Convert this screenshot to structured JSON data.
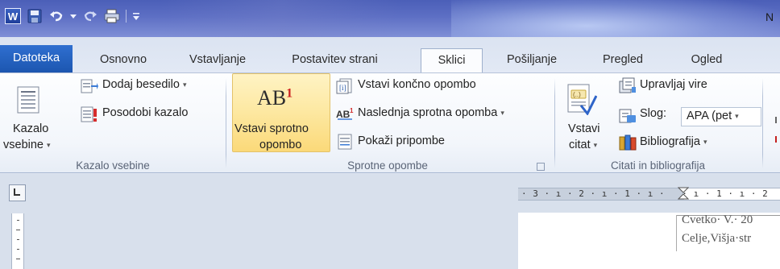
{
  "window": {
    "title_fragment": "N"
  },
  "qat": {
    "icons": [
      "word-logo-icon",
      "save-icon",
      "undo-icon",
      "dropdown-icon",
      "redo-icon",
      "print-icon",
      "customize-icon"
    ],
    "logo_letter": "W"
  },
  "tabs": [
    {
      "label": "Datoteka",
      "active": false,
      "file": true
    },
    {
      "label": "Osnovno",
      "active": false
    },
    {
      "label": "Vstavljanje",
      "active": false
    },
    {
      "label": "Postavitev strani",
      "active": false
    },
    {
      "label": "Sklici",
      "active": true
    },
    {
      "label": "Pošiljanje",
      "active": false
    },
    {
      "label": "Pregled",
      "active": false
    },
    {
      "label": "Ogled",
      "active": false
    }
  ],
  "ribbon": {
    "toc_group": {
      "label": "Kazalo vsebine",
      "toc_button_line1": "Kazalo",
      "toc_button_line2": "vsebine",
      "add_text": "Dodaj besedilo",
      "update_table": "Posodobi kazalo"
    },
    "footnotes_group": {
      "label": "Sprotne opombe",
      "insert_footnote_line1": "Vstavi sprotno",
      "insert_footnote_line2": "opombo",
      "insert_footnote_icon_text": "AB",
      "insert_footnote_icon_sup": "1",
      "insert_endnote": "Vstavi končno opombo",
      "next_footnote": "Naslednja sprotna opomba",
      "show_notes": "Pokaži pripombe"
    },
    "citations_group": {
      "label": "Citati in bibliografija",
      "insert_citation_line1": "Vstavi",
      "insert_citation_line2": "citat",
      "manage_sources": "Upravljaj vire",
      "style_label": "Slog:",
      "style_value": "APA (pet",
      "bibliography": "Bibliografija"
    }
  },
  "ruler": {
    "numbers": "· 3 · ı · 2 · ı · 1 · ı ·   · ı · 1 · ı · 2"
  },
  "document": {
    "line1": "Cvetko· V.· 20",
    "line2": "Celje,Višja·str"
  },
  "colors": {
    "file_tab": "#1c56b0",
    "highlight": "#fde9a4",
    "title_bar": "#5d6fc4"
  }
}
